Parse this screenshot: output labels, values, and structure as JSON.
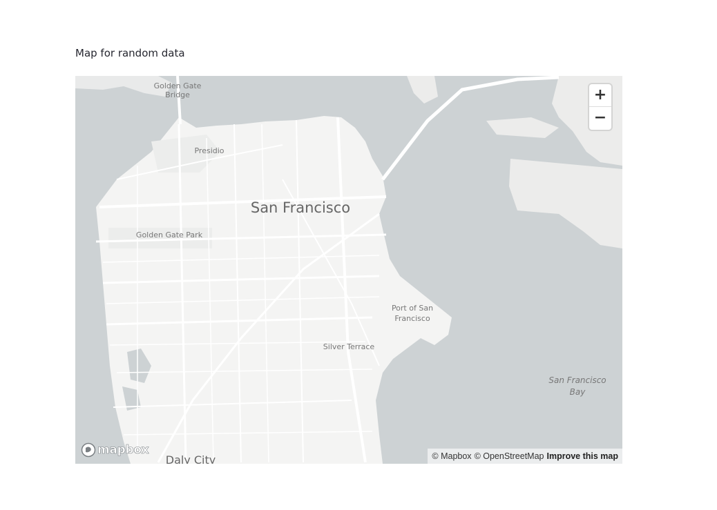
{
  "caption": "Map for random data",
  "map": {
    "labels": {
      "city": "San Francisco",
      "golden_gate_bridge": [
        "Golden Gate",
        "Bridge"
      ],
      "presidio": "Presidio",
      "golden_gate_park": "Golden Gate Park",
      "port_of_sf": [
        "Port of San",
        "Francisco"
      ],
      "silver_terrace": "Silver Terrace",
      "sf_bay": [
        "San Francisco",
        "Bay"
      ],
      "daly_city": "Daly City"
    },
    "zoom_in_label": "+",
    "zoom_out_label": "−",
    "logo_text": "mapbox",
    "attribution": {
      "mapbox": "© Mapbox",
      "osm": "© OpenStreetMap",
      "improve": "Improve this map"
    },
    "colors": {
      "water": "#cdd2d4",
      "land": "#f4f4f3",
      "road": "#ffffff",
      "label": "#777777"
    },
    "icons": [
      "mapbox-logo-icon"
    ]
  }
}
